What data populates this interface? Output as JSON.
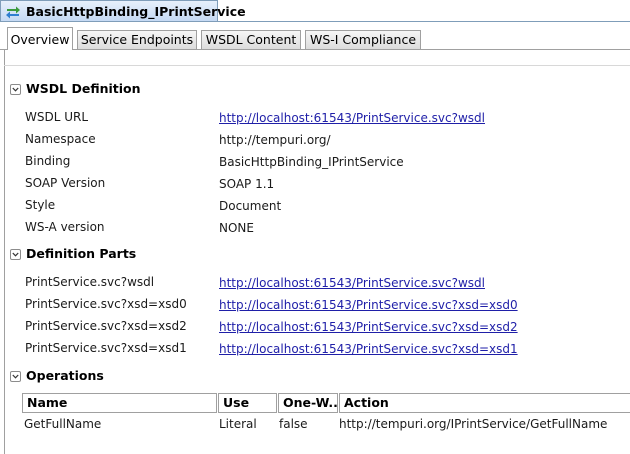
{
  "window": {
    "title": "BasicHttpBinding_IPrintService"
  },
  "tabs": [
    {
      "label": "Overview",
      "active": true
    },
    {
      "label": "Service Endpoints",
      "active": false
    },
    {
      "label": "WSDL Content",
      "active": false
    },
    {
      "label": "WS-I Compliance",
      "active": false
    }
  ],
  "wsdl_definition": {
    "title": "WSDL Definition",
    "rows": [
      {
        "label": "WSDL URL",
        "value": "http://localhost:61543/PrintService.svc?wsdl",
        "link": true
      },
      {
        "label": "Namespace",
        "value": "http://tempuri.org/",
        "link": false
      },
      {
        "label": "Binding",
        "value": "BasicHttpBinding_IPrintService",
        "link": false
      },
      {
        "label": "SOAP Version",
        "value": "SOAP 1.1",
        "link": false
      },
      {
        "label": "Style",
        "value": "Document",
        "link": false
      },
      {
        "label": "WS-A version",
        "value": "NONE",
        "link": false
      }
    ]
  },
  "definition_parts": {
    "title": "Definition Parts",
    "rows": [
      {
        "label": "PrintService.svc?wsdl",
        "value": "http://localhost:61543/PrintService.svc?wsdl"
      },
      {
        "label": "PrintService.svc?xsd=xsd0",
        "value": "http://localhost:61543/PrintService.svc?xsd=xsd0"
      },
      {
        "label": "PrintService.svc?xsd=xsd2",
        "value": "http://localhost:61543/PrintService.svc?xsd=xsd2"
      },
      {
        "label": "PrintService.svc?xsd=xsd1",
        "value": "http://localhost:61543/PrintService.svc?xsd=xsd1"
      }
    ]
  },
  "operations": {
    "title": "Operations",
    "columns": [
      "Name",
      "Use",
      "One-W...",
      "Action"
    ],
    "rows": [
      {
        "name": "GetFullName",
        "use": "Literal",
        "one_way": "false",
        "action": "http://tempuri.org/IPrintService/GetFullName"
      }
    ]
  },
  "colors": {
    "link": "#1f1fa8",
    "title_tab": "#c3d8f3",
    "border": "#a0a0a0"
  }
}
